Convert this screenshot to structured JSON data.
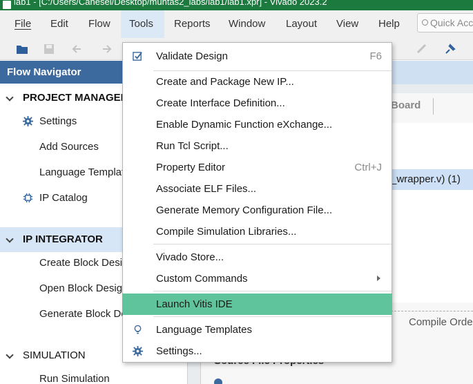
{
  "window": {
    "title": "lab1 - [C:/Users/Canesel/Desktop/muntas2_labs/lab1/lab1.xpr] - Vivado 2023.2"
  },
  "menubar": {
    "items": [
      {
        "label": "File"
      },
      {
        "label": "Edit"
      },
      {
        "label": "Flow"
      },
      {
        "label": "Tools"
      },
      {
        "label": "Reports"
      },
      {
        "label": "Window"
      },
      {
        "label": "Layout"
      },
      {
        "label": "View"
      },
      {
        "label": "Help"
      }
    ],
    "quick_access_placeholder": "Quick Access"
  },
  "flow_navigator": {
    "title": "Flow Navigator",
    "project_manager": {
      "label": "PROJECT MANAGER",
      "items": [
        "Settings",
        "Add Sources",
        "Language Templates",
        "IP Catalog"
      ]
    },
    "ip_integrator": {
      "label": "IP INTEGRATOR",
      "items": [
        "Create Block Design",
        "Open Block Design",
        "Generate Block Design"
      ]
    },
    "simulation": {
      "label": "SIMULATION",
      "items": [
        "Run Simulation"
      ]
    }
  },
  "right_panel": {
    "board_tab": "Board",
    "wrapper_item": "_wrapper.v) (1)",
    "compile_order_tab": "Compile Order",
    "source_file_properties": "Source File Properties"
  },
  "tools_menu": {
    "items": [
      {
        "label": "Validate Design",
        "shortcut": "F6",
        "icon": "checkbox-icon"
      },
      {
        "label": "Create and Package New IP..."
      },
      {
        "label": "Create Interface Definition..."
      },
      {
        "label": "Enable Dynamic Function eXchange..."
      },
      {
        "label": "Run Tcl Script..."
      },
      {
        "label": "Property Editor",
        "shortcut": "Ctrl+J"
      },
      {
        "label": "Associate ELF Files..."
      },
      {
        "label": "Generate Memory Configuration File..."
      },
      {
        "label": "Compile Simulation Libraries..."
      },
      {
        "label": "Vivado Store..."
      },
      {
        "label": "Custom Commands",
        "submenu": true
      },
      {
        "label": "Launch Vitis IDE",
        "highlighted": true
      },
      {
        "label": "Language Templates",
        "icon": "lightbulb-icon"
      },
      {
        "label": "Settings...",
        "icon": "gear-icon"
      }
    ]
  },
  "colors": {
    "title_bar": "#1d7a3f",
    "flow_nav_header": "#3c6a9e",
    "menu_highlight": "#5fc49c",
    "section_highlight": "#d6e6f6"
  }
}
